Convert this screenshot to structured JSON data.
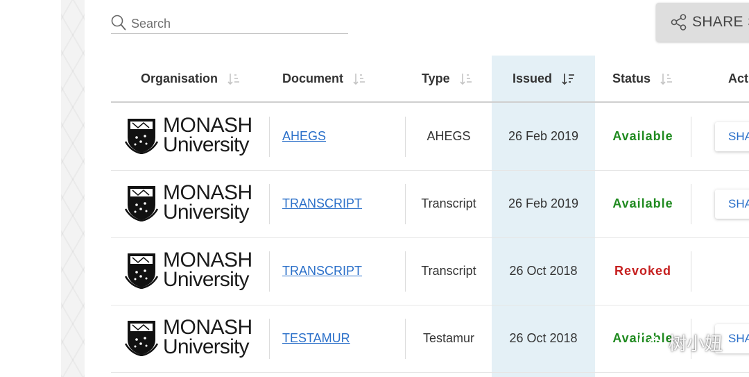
{
  "search": {
    "placeholder": "Search"
  },
  "share_button": {
    "label": "SHARE S"
  },
  "columns": [
    {
      "label": "Organisation"
    },
    {
      "label": "Document"
    },
    {
      "label": "Type"
    },
    {
      "label": "Issued"
    },
    {
      "label": "Status"
    },
    {
      "label": "Acti"
    }
  ],
  "rows": [
    {
      "org_line1": "MONASH",
      "org_line2": "University",
      "document": "AHEGS",
      "type": "AHEGS",
      "issued": "26 Feb 2019",
      "status": "Available",
      "share": "SHA"
    },
    {
      "org_line1": "MONASH",
      "org_line2": "University",
      "document": "TRANSCRIPT",
      "type": "Transcript",
      "issued": "26 Feb 2019",
      "status": "Available",
      "share": "SHA"
    },
    {
      "org_line1": "MONASH",
      "org_line2": "University",
      "document": "TRANSCRIPT",
      "type": "Transcript",
      "issued": "26 Oct 2018",
      "status": "Revoked",
      "share": ""
    },
    {
      "org_line1": "MONASH",
      "org_line2": "University",
      "document": "TESTAMUR",
      "type": "Testamur",
      "issued": "26 Oct 2018",
      "status": "Available",
      "share": "SHA"
    }
  ],
  "watermark": {
    "text": "树小妞"
  },
  "colors": {
    "issued_highlight": "#e4f0f6",
    "available": "#1f8a1f",
    "revoked": "#c62020",
    "link": "#2a6fc9"
  }
}
